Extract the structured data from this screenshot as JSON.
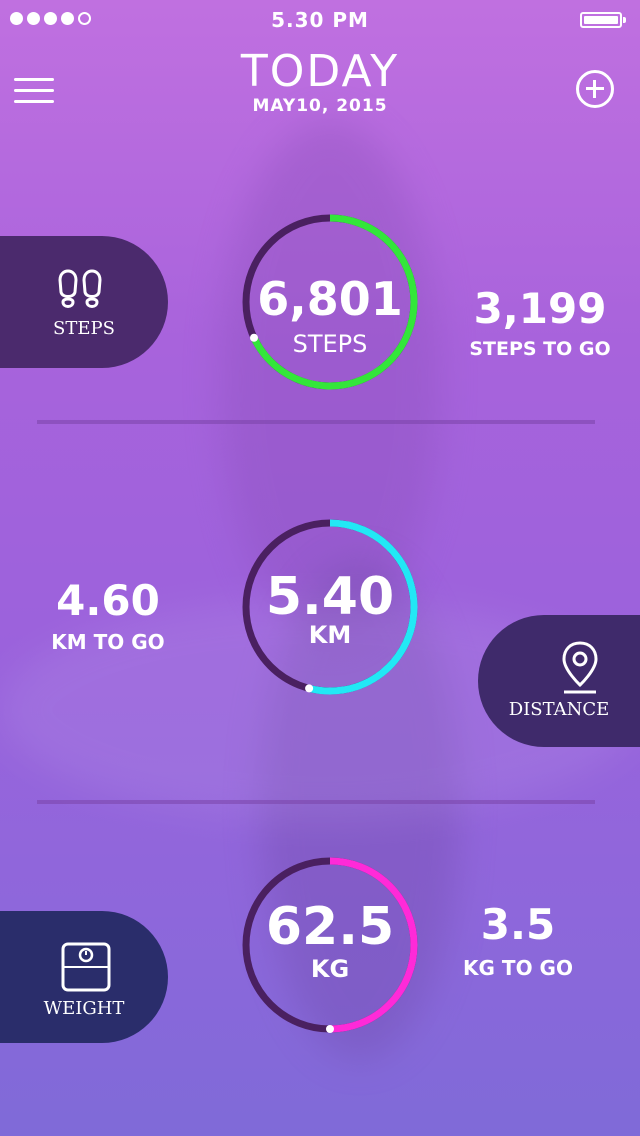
{
  "status_bar": {
    "signal_dots_filled": 4,
    "signal_dots_total": 5,
    "time": "5.30 PM",
    "battery_level": 1.0
  },
  "header": {
    "title": "TODAY",
    "date": "MAY10,  2015",
    "menu_icon": "hamburger-menu-icon",
    "add_icon": "plus-circle-icon"
  },
  "steps": {
    "pill_label": "STEPS",
    "pill_icon": "footprints-icon",
    "value": "6,801",
    "unit": "STEPS",
    "to_go_value": "3,199",
    "to_go_label": "STEPS TO GO",
    "progress": 0.68,
    "color": "#33e63a"
  },
  "distance": {
    "pill_label": "DISTANCE",
    "pill_icon": "location-pin-icon",
    "value": "5.40",
    "unit": "KM",
    "to_go_value": "4.60",
    "to_go_label": "KM TO GO",
    "progress": 0.54,
    "color": "#22e8f5"
  },
  "weight": {
    "pill_label": "WEIGHT",
    "pill_icon": "scale-icon",
    "value": "62.5",
    "unit": "KG",
    "to_go_value": "3.5",
    "to_go_label": "KG TO GO",
    "progress": 0.5,
    "color": "#ff2ad8"
  },
  "colors": {
    "ring_track": "#4a2060",
    "pill_steps": "#4b2a6d",
    "pill_distance": "#3f2a6b",
    "pill_weight": "#2a2d6b"
  }
}
